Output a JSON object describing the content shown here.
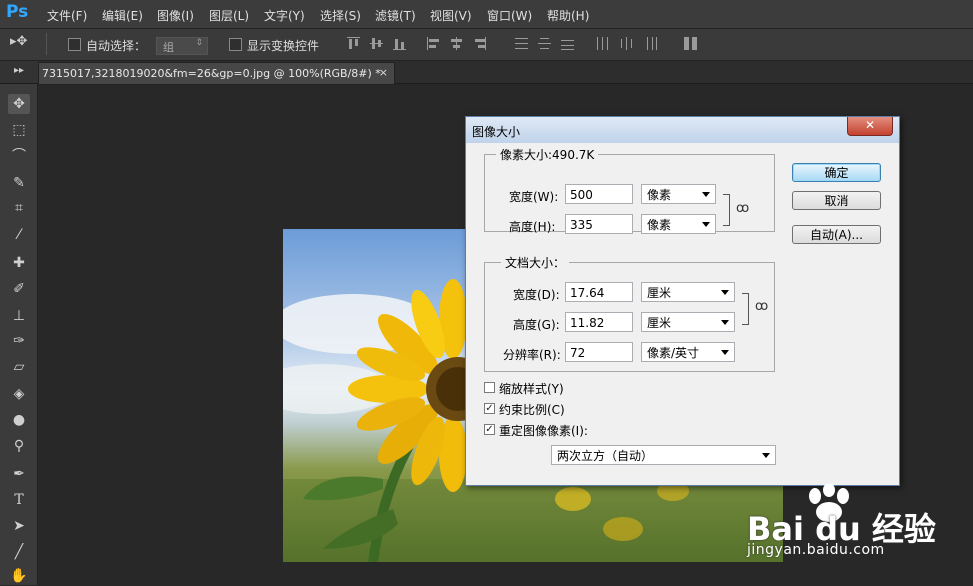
{
  "app": {
    "logo": "Ps"
  },
  "menu": [
    "文件(F)",
    "编辑(E)",
    "图像(I)",
    "图层(L)",
    "文字(Y)",
    "选择(S)",
    "滤镜(T)",
    "视图(V)",
    "窗口(W)",
    "帮助(H)"
  ],
  "options_bar": {
    "auto_select_label": "自动选择：",
    "auto_select_value": "组",
    "show_transform_label": "显示变换控件"
  },
  "doc_tab": {
    "title": "7315017,3218019020&fm=26&gp=0.jpg @ 100%(RGB/8#) *",
    "close": "×"
  },
  "toolbox": {
    "collapse_glyph": "▸▸",
    "tools": [
      {
        "icon": "move-icon",
        "glyph": "✥"
      },
      {
        "icon": "marquee-icon",
        "glyph": "⬚"
      },
      {
        "icon": "lasso-icon",
        "glyph": "⌒"
      },
      {
        "icon": "quick-select-icon",
        "glyph": "✎"
      },
      {
        "icon": "crop-icon",
        "glyph": "⌗"
      },
      {
        "icon": "eyedropper-icon",
        "glyph": "⁄"
      },
      {
        "icon": "healing-brush-icon",
        "glyph": "✚"
      },
      {
        "icon": "brush-icon",
        "glyph": "✐"
      },
      {
        "icon": "stamp-icon",
        "glyph": "⊥"
      },
      {
        "icon": "history-brush-icon",
        "glyph": "✑"
      },
      {
        "icon": "eraser-icon",
        "glyph": "▱"
      },
      {
        "icon": "paint-bucket-icon",
        "glyph": "◈"
      },
      {
        "icon": "blur-icon",
        "glyph": "●"
      },
      {
        "icon": "dodge-icon",
        "glyph": "⚲"
      },
      {
        "icon": "pen-icon",
        "glyph": "✒"
      },
      {
        "icon": "type-icon",
        "glyph": "T"
      },
      {
        "icon": "path-select-icon",
        "glyph": "➤"
      },
      {
        "icon": "line-icon",
        "glyph": "╱"
      },
      {
        "icon": "hand-icon",
        "glyph": "✋"
      }
    ]
  },
  "dialog": {
    "title": "图像大小",
    "close_glyph": "✕",
    "pixel_dimensions": {
      "legend": "像素大小:490.7K",
      "width_label": "宽度(W):",
      "width_value": "500",
      "width_unit": "像素",
      "height_label": "高度(H):",
      "height_value": "335",
      "height_unit": "像素"
    },
    "document_size": {
      "legend": "文档大小：",
      "width_label": "宽度(D):",
      "width_value": "17.64",
      "width_unit": "厘米",
      "height_label": "高度(G):",
      "height_value": "11.82",
      "height_unit": "厘米",
      "resolution_label": "分辨率(R):",
      "resolution_value": "72",
      "resolution_unit": "像素/英寸"
    },
    "scale_styles": {
      "label": "缩放样式(Y)",
      "checked": false
    },
    "constrain_proportions": {
      "label": "约束比例(C)",
      "checked": true
    },
    "resample": {
      "label": "重定图像像素(I):",
      "checked": true,
      "method": "两次立方（自动）"
    },
    "buttons": {
      "ok": "确定",
      "cancel": "取消",
      "auto": "自动(A)..."
    },
    "chain_glyph": "ꝏ"
  },
  "watermark": {
    "brand": "Bai du 经验",
    "url": "jingyan.baidu.com"
  }
}
